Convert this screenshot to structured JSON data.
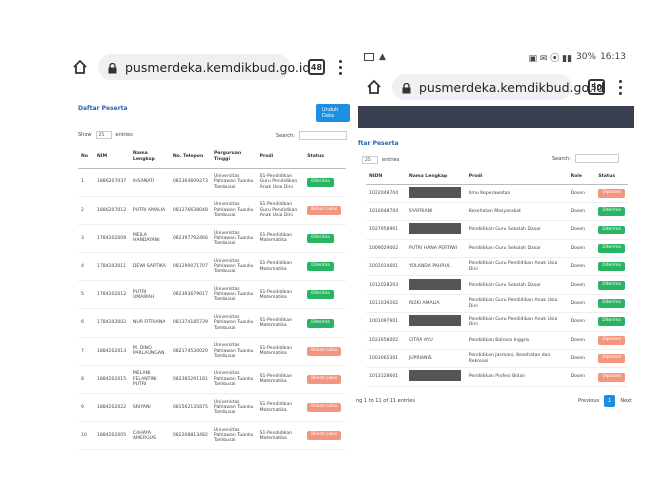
{
  "left": {
    "url": "pusmerdeka.kemdikbud.go.id",
    "tab_count": "48",
    "page_title": "Daftar Peserta",
    "unduh_button": "Unduh Data",
    "show_label": "Show",
    "show_value": "25",
    "entries_label": "entries",
    "search_label": "Search:",
    "headers": [
      "No",
      "NIM",
      "Nama Lengkap",
      "No. Telepon",
      "Perguruan Tinggi",
      "Prodi",
      "Status"
    ],
    "rows": [
      {
        "no": "1",
        "nim": "1886207037",
        "nama": "IHSANATI",
        "tel": "081364609273",
        "pt": "Universitas Pahlawan Tuanku Tambusai",
        "prodi": "S1-Pendidikan Guru Pendidikan Anak Usia Dini",
        "status": "Diterima"
      },
      {
        "no": "2",
        "nim": "1886207012",
        "nama": "PUTRI AMALIA",
        "tel": "081276638048",
        "pt": "Universitas Pahlawan Tuanku Tambusai",
        "prodi": "S1-Pendidikan Guru Pendidikan Anak Usia Dini",
        "status": "Belum Lolos"
      },
      {
        "no": "3",
        "nim": "1784202008",
        "nama": "MEILA HANDAYANI",
        "tel": "082397792466",
        "pt": "Universitas Pahlawan Tuanku Tambusai",
        "prodi": "S1-Pendidikan Matematika",
        "status": "Diterima"
      },
      {
        "no": "4",
        "nim": "1784202011",
        "nama": "DEWI SARTIKA",
        "tel": "081290071707",
        "pt": "Universitas Pahlawan Tuanku Tambusai",
        "prodi": "S1-Pendidikan Matematika",
        "status": "Diterima"
      },
      {
        "no": "5",
        "nim": "1784202012",
        "nama": "PUTRI UMAIRAH",
        "tel": "082393679017",
        "pt": "Universitas Pahlawan Tuanku Tambusai",
        "prodi": "S1-Pendidikan Matematika",
        "status": "Diterima"
      },
      {
        "no": "6",
        "nim": "1784202002",
        "nama": "NUR FITRIANA",
        "tel": "081374185739",
        "pt": "Universitas Pahlawan Tuanku Tambusai",
        "prodi": "S1-Pendidikan Matematika",
        "status": "Diterima"
      },
      {
        "no": "7",
        "nim": "1884202013",
        "nama": "M. DINO PARLAUNGAN",
        "tel": "082174530020",
        "pt": "Universitas Pahlawan Tuanku Tambusai",
        "prodi": "S1-Pendidikan Matematika",
        "status": "Belum Lolos"
      },
      {
        "no": "8",
        "nim": "1884202015",
        "nama": "MELANI FELANTINI PUTRI",
        "tel": "082385291181",
        "pt": "Universitas Pahlawan Tuanku Tambusai",
        "prodi": "S1-Pendidikan Matematika",
        "status": "Belum Lolos"
      },
      {
        "no": "9",
        "nim": "1884202022",
        "nama": "SRIYANI",
        "tel": "081562135875",
        "pt": "Universitas Pahlawan Tuanku Tambusai",
        "prodi": "S1-Pendidikan Matematika",
        "status": "Belum Lolos"
      },
      {
        "no": "10",
        "nim": "1884202005",
        "nama": "CAHAYA AMERGUS",
        "tel": "082268813482",
        "pt": "Universitas Pahlawan Tuanku Tambusai",
        "prodi": "S1-Pendidikan Matematika",
        "status": "Belum Lolos"
      }
    ]
  },
  "right": {
    "status_bar": {
      "battery": "30%",
      "time": "16:13"
    },
    "url": "pusmerdeka.kemdikbud.go.id",
    "tab_count": "50",
    "page_title": "ftar Peserta",
    "show_value": "25",
    "entries_label": "entries",
    "search_label": "Search:",
    "headers": [
      "NIDN",
      "Nama Lengkap",
      "Prodi",
      "Role",
      "Status"
    ],
    "rows": [
      {
        "nidn": "1022048704",
        "nama": "",
        "redacted": true,
        "prodi": "Ilmu Keperawatan",
        "role": "Dosen",
        "status": "Diproses"
      },
      {
        "nidn": "1010048704",
        "nama": "SYAFRIANI",
        "redacted": false,
        "prodi": "Kesehatan Masyarakat",
        "role": "Dosen",
        "status": "Diterima"
      },
      {
        "nidn": "1027058901",
        "nama": "",
        "redacted": true,
        "prodi": "Pendidikan Guru Sekolah Dasar",
        "role": "Dosen",
        "status": "Diterima"
      },
      {
        "nidn": "1009029002",
        "nama": "PUTRI HANA PERTIWI",
        "redacted": false,
        "prodi": "Pendidikan Guru Sekolah Dasar",
        "role": "Dosen",
        "status": "Diterima"
      },
      {
        "nidn": "1002014601",
        "nama": "YOLANDA PAHRUL",
        "redacted": false,
        "prodi": "Pendidikan Guru Pendidikan Anak Usia Dini",
        "role": "Dosen",
        "status": "Diterima"
      },
      {
        "nidn": "1012028203",
        "nama": "",
        "redacted": true,
        "prodi": "Pendidikan Guru Sekolah Dasar",
        "role": "Dosen",
        "status": "Diterima"
      },
      {
        "nidn": "1011039202",
        "nama": "RIZKI AMALIA",
        "redacted": false,
        "prodi": "Pendidikan Guru Pendidikan Anak Usia Dini",
        "role": "Dosen",
        "status": "Diterima"
      },
      {
        "nidn": "1001097901",
        "nama": "",
        "redacted": true,
        "prodi": "Pendidikan Guru Pendidikan Anak Usia Dini",
        "role": "Dosen",
        "status": "Diterima"
      },
      {
        "nidn": "1023058002",
        "nama": "CITRA AYU",
        "redacted": false,
        "prodi": "Pendidikan Bahasa Inggris",
        "role": "Dosen",
        "status": "Diproses"
      },
      {
        "nidn": "1003065301",
        "nama": "JUPRIANIS",
        "redacted": false,
        "prodi": "Pendidikan Jasmani, Kesehatan dan Rekreasi",
        "role": "Dosen",
        "status": "Diproses"
      },
      {
        "nidn": "1013128601",
        "nama": "",
        "redacted": true,
        "prodi": "Pendidikan Profesi Bidan",
        "role": "Dosen",
        "status": "Diproses"
      }
    ],
    "footer_info": "ng 1 to 11 of 11 entries",
    "pager": {
      "previous": "Previous",
      "current": "1",
      "next": "Next"
    }
  },
  "colors": {
    "diterima": "#28b463",
    "pending": "#f39680",
    "primary": "#1e8fe0"
  }
}
